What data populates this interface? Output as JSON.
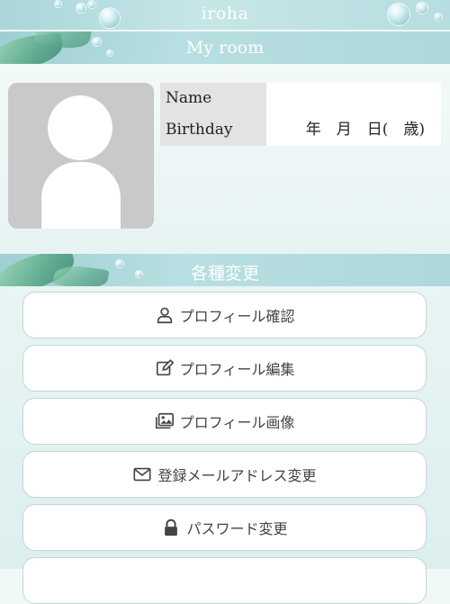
{
  "app": {
    "title": "iroha"
  },
  "my_room": {
    "header": "My room",
    "profile": {
      "name_label": "Name",
      "name_value": "",
      "birthday_label": "Birthday",
      "birthday_value": "年　月　日(　歳)"
    }
  },
  "settings": {
    "header": "各種変更",
    "items": [
      {
        "label": "プロフィール確認",
        "icon": "user-icon"
      },
      {
        "label": "プロフィール編集",
        "icon": "edit-icon"
      },
      {
        "label": "プロフィール画像",
        "icon": "images-icon"
      },
      {
        "label": "登録メールアドレス変更",
        "icon": "envelope-icon"
      },
      {
        "label": "パスワード変更",
        "icon": "lock-icon"
      }
    ]
  },
  "colors": {
    "header_teal": "#aed8dc",
    "avatar_gray": "#c9c9c9",
    "page_bg": "#f1f8f8"
  }
}
